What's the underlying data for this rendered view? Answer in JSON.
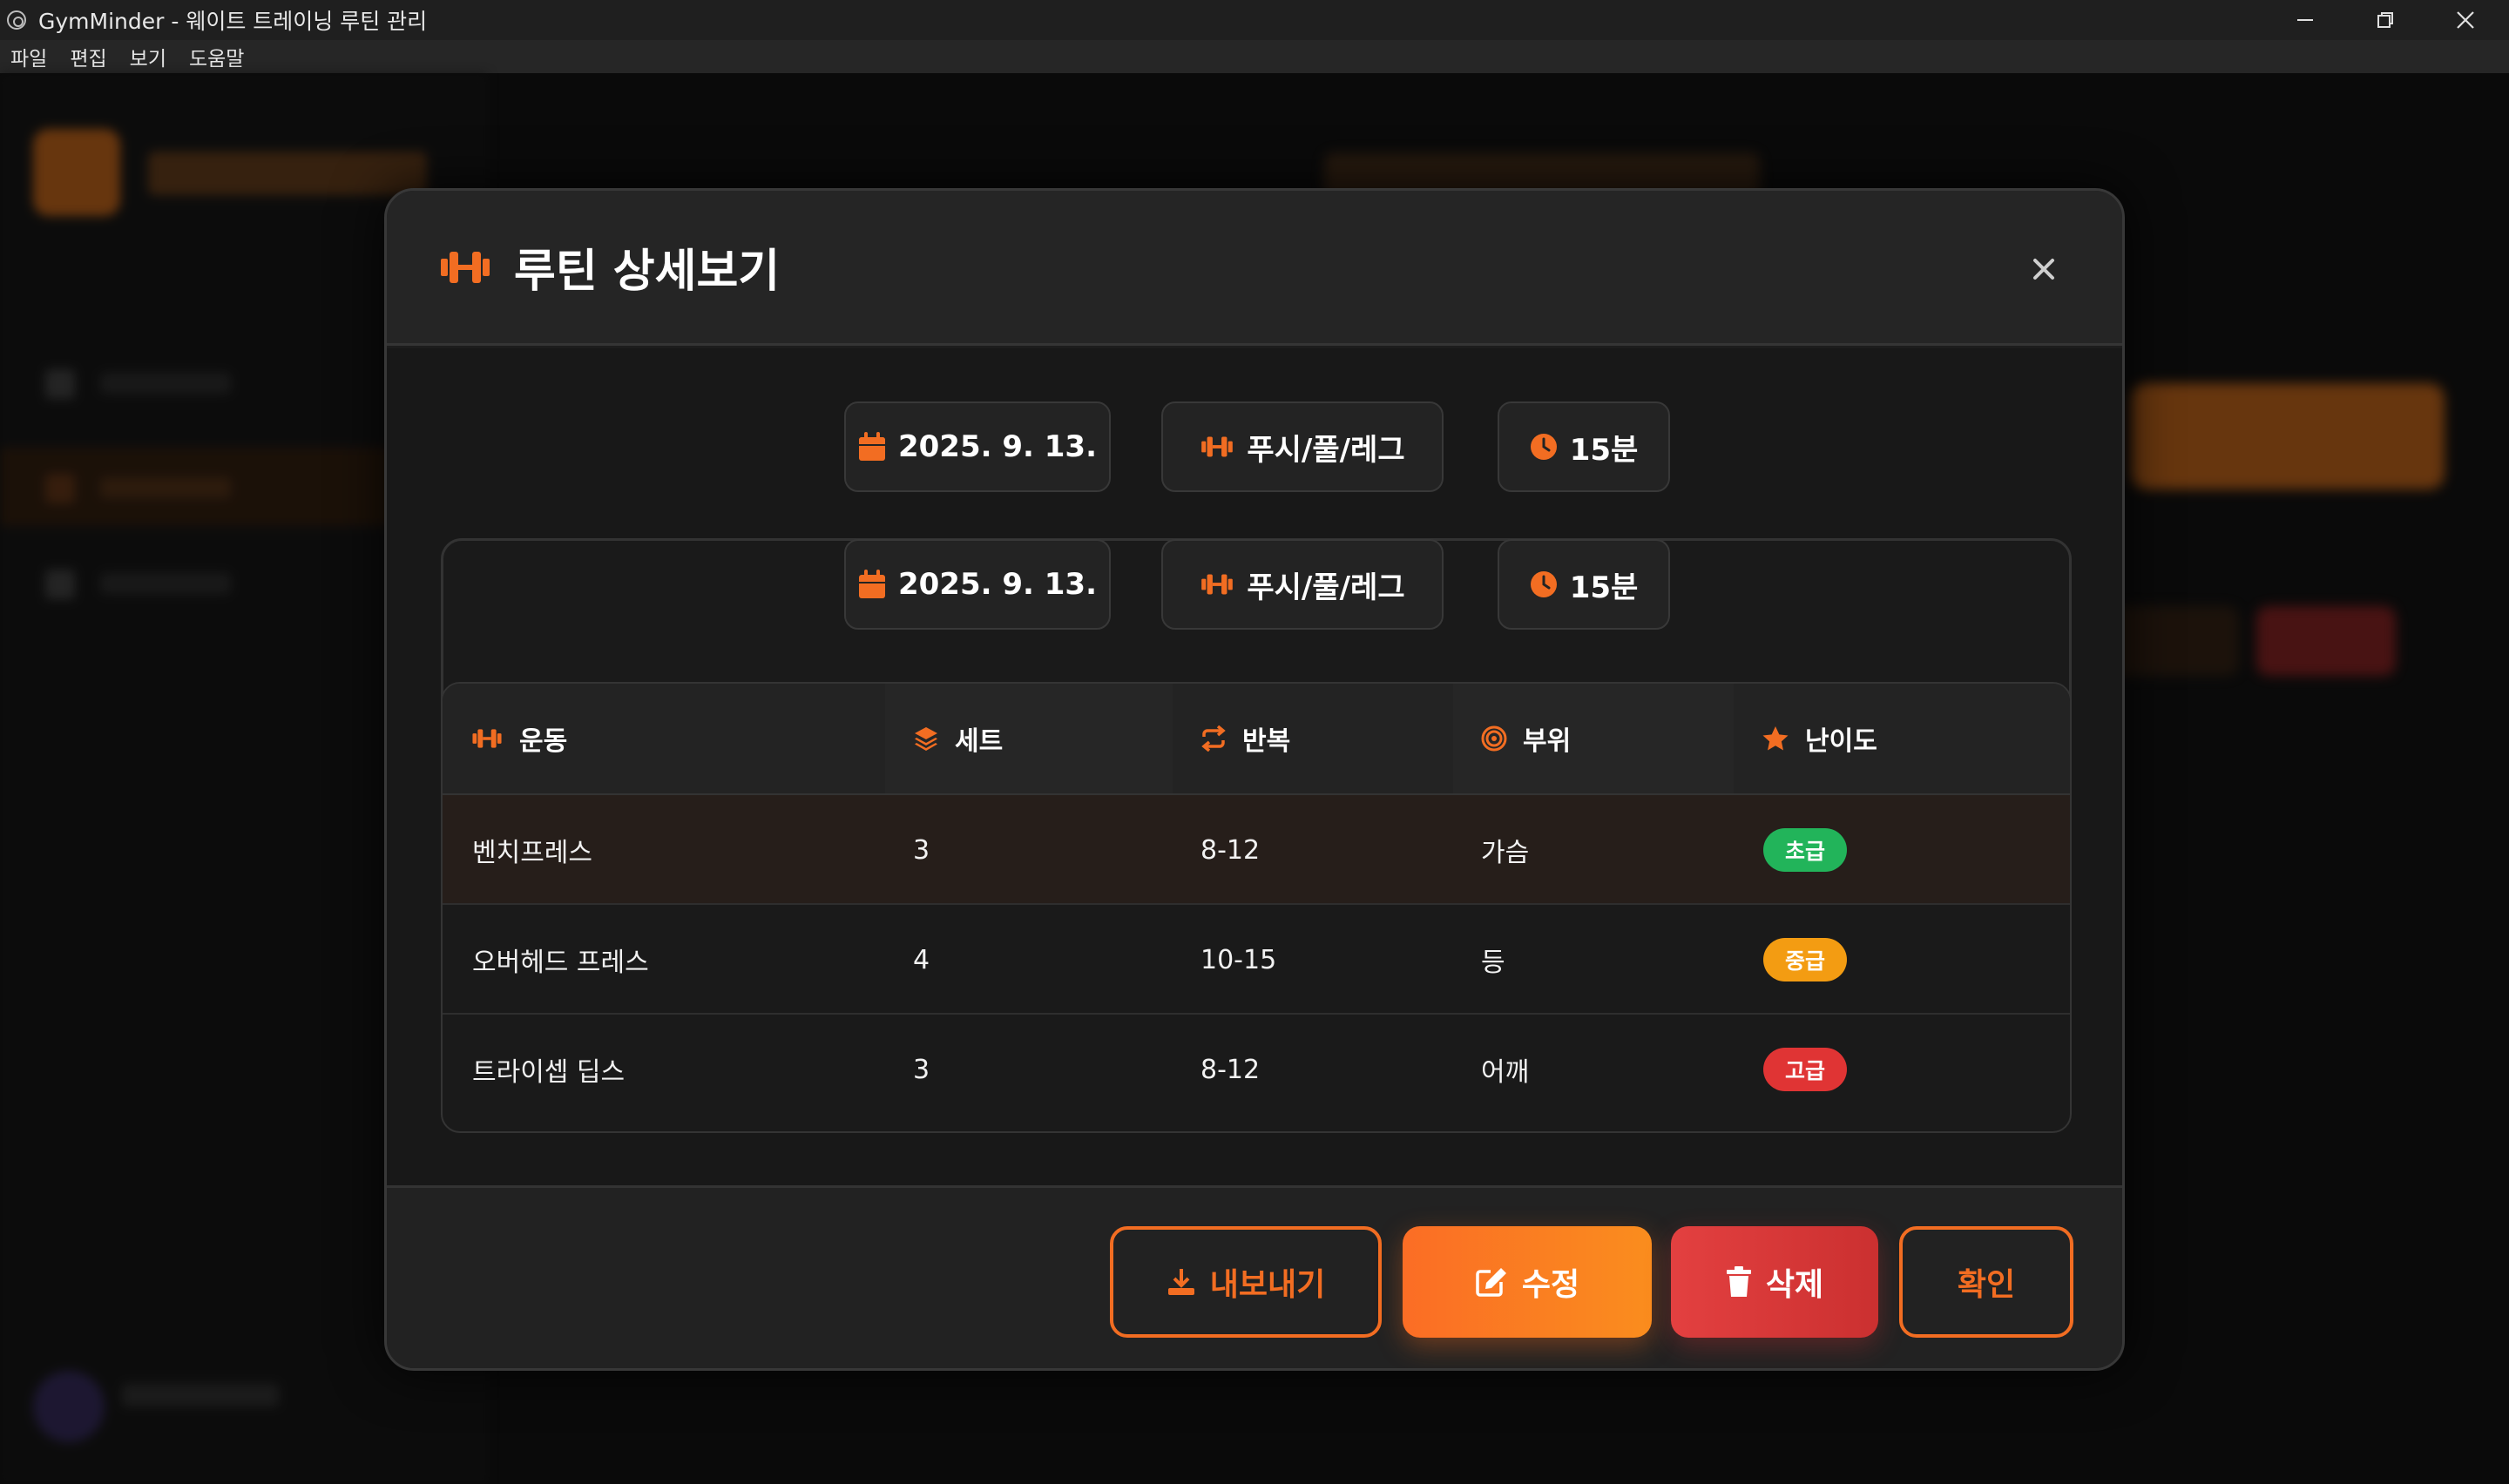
{
  "window": {
    "title": "GymMinder - 웨이트 트레이닝 루틴 관리",
    "controls": [
      "minimize",
      "restore",
      "close"
    ]
  },
  "menubar": {
    "items": [
      "파일",
      "편집",
      "보기",
      "도움말"
    ]
  },
  "modal": {
    "title": "루틴 상세보기",
    "close_symbol": "×",
    "summary_chips": {
      "date": "2025. 9. 13.",
      "type": "푸시/풀/레그",
      "duration": "15분"
    },
    "detail_chips": {
      "date": "2025. 9. 13.",
      "type": "푸시/풀/레그",
      "duration": "15분"
    },
    "table": {
      "headers": {
        "exercise": "운동",
        "sets": "세트",
        "reps": "반복",
        "muscle": "부위",
        "difficulty": "난이도"
      },
      "rows": [
        {
          "exercise": "벤치프레스",
          "sets": "3",
          "reps": "8-12",
          "muscle": "가슴",
          "difficulty": "초급",
          "difficulty_color": "#22b45a"
        },
        {
          "exercise": "오버헤드 프레스",
          "sets": "4",
          "reps": "10-15",
          "muscle": "등",
          "difficulty": "중급",
          "difficulty_color": "#f39c12"
        },
        {
          "exercise": "트라이셉 딥스",
          "sets": "3",
          "reps": "8-12",
          "muscle": "어깨",
          "difficulty": "고급",
          "difficulty_color": "#e03434"
        }
      ]
    },
    "footer": {
      "export_label": "내보내기",
      "edit_label": "수정",
      "delete_label": "삭제",
      "confirm_label": "확인"
    }
  },
  "colors": {
    "accent": "#f26d22",
    "danger": "#e03a3a",
    "beginner": "#22b45a",
    "intermediate": "#f39c12",
    "advanced": "#e03434"
  },
  "icons": {
    "header": "dumbbell-icon",
    "date": "calendar-icon",
    "type": "dumbbell-icon",
    "duration": "clock-icon",
    "exercise": "dumbbell-icon",
    "sets": "layers-icon",
    "reps": "repeat-icon",
    "muscle": "target-icon",
    "difficulty": "star-icon",
    "export": "download-icon",
    "edit": "edit-icon",
    "delete": "trash-icon"
  }
}
